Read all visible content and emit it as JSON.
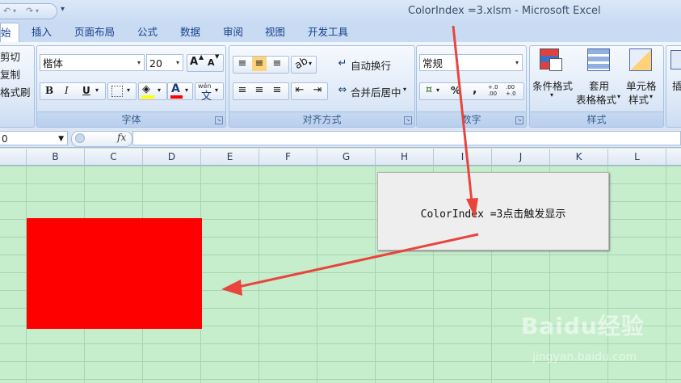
{
  "window": {
    "title": "ColorIndex =3.xlsm - Microsoft Excel"
  },
  "quick_access": {
    "undo_icon": "undo-icon",
    "redo_icon": "redo-icon",
    "customize": "▾"
  },
  "tabs": [
    {
      "label": "始"
    },
    {
      "label": "插入"
    },
    {
      "label": "页面布局"
    },
    {
      "label": "公式"
    },
    {
      "label": "数据"
    },
    {
      "label": "审阅"
    },
    {
      "label": "视图"
    },
    {
      "label": "开发工具"
    }
  ],
  "clipboard": {
    "cut": "剪切",
    "copy": "复制",
    "format_painter": "格式刷"
  },
  "font": {
    "group_label": "字体",
    "font_name": "楷体",
    "font_size": "20",
    "grow": "A",
    "shrink": "A",
    "bold": "B",
    "italic": "I",
    "underline": "U",
    "font_color_letter": "A",
    "phonetic_top": "wén",
    "phonetic_char": "文"
  },
  "alignment": {
    "group_label": "对齐方式",
    "wrap_text": "自动换行",
    "merge_center": "合并后居中"
  },
  "number": {
    "group_label": "数字",
    "format": "常规",
    "percent": "%",
    "comma": ",",
    "dec_inc": "+.0 .00",
    "dec_dec": ".00 +.0"
  },
  "styles": {
    "group_label": "样式",
    "conditional": "条件格式",
    "table_line1": "套用",
    "table_line2": "表格格式",
    "cell_line1": "单元格",
    "cell_line2": "样式"
  },
  "cells": {
    "insert": "插"
  },
  "formula_bar": {
    "name_box": "0",
    "fx": "fx"
  },
  "columns": [
    "B",
    "C",
    "D",
    "E",
    "F",
    "G",
    "H",
    "I",
    "J",
    "K",
    "L"
  ],
  "macro_button": {
    "label": "ColorIndex =3点击触发显示"
  },
  "colors": {
    "shape_fill": "#ff0000",
    "sheet_background": "#c6eecd",
    "arrow": "#e8453c"
  },
  "watermark": {
    "brand": "Baidu经验",
    "url": "jingyan.baidu.com"
  }
}
